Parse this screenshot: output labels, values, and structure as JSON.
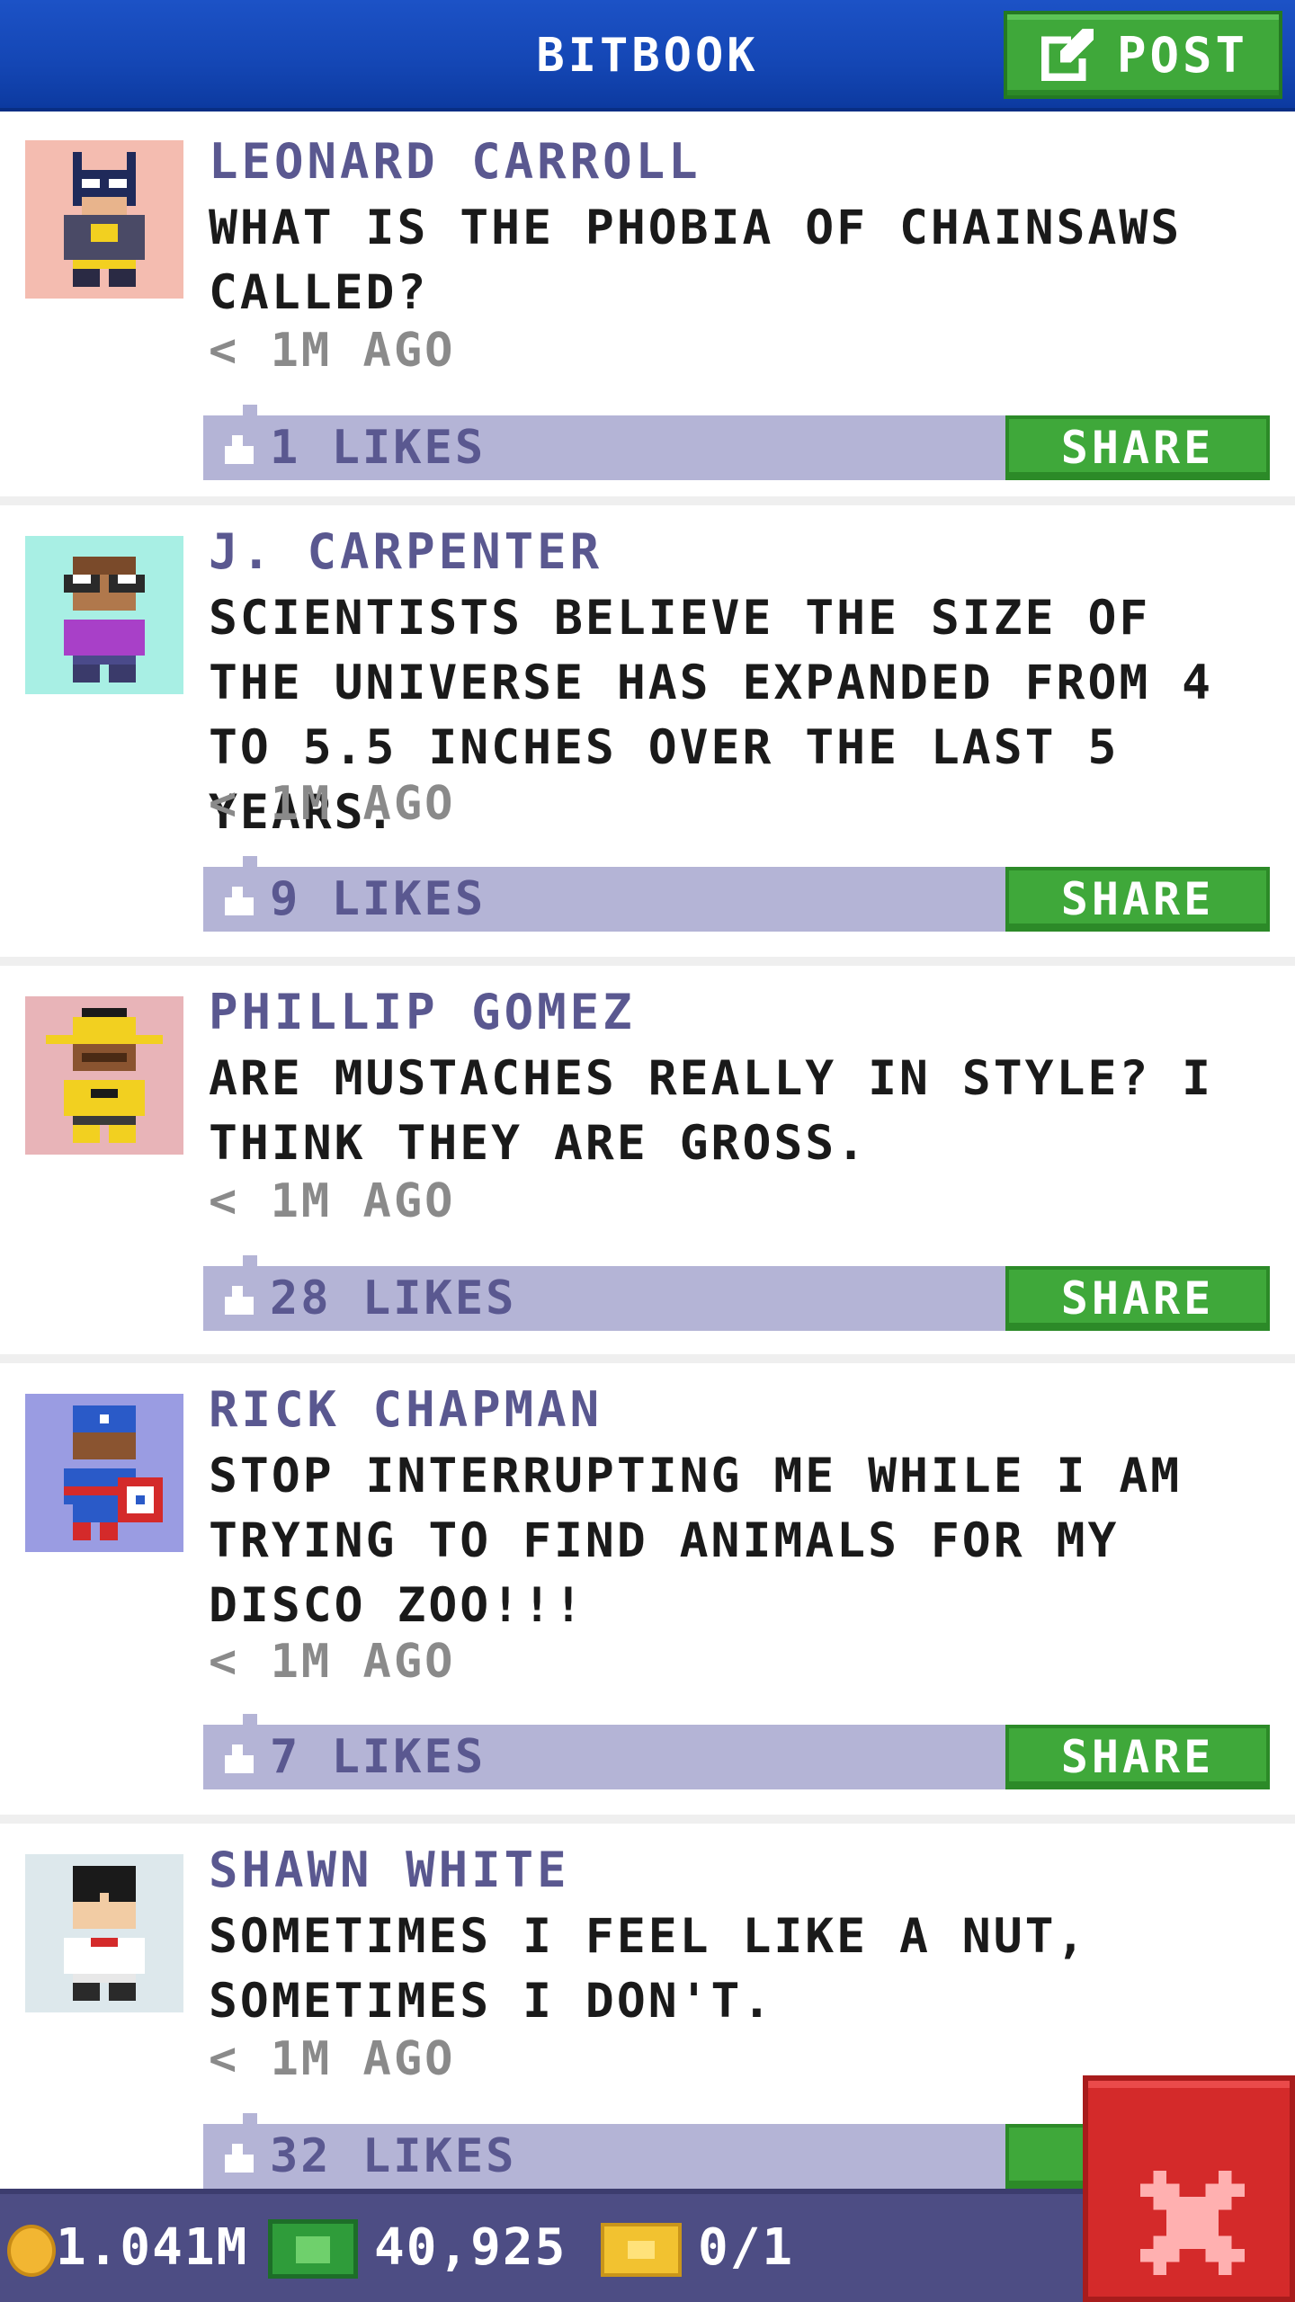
{
  "header": {
    "title": "BITBOOK",
    "post_label": "POST"
  },
  "posts": [
    {
      "author": "LEONARD CARROLL",
      "text": "WHAT IS THE PHOBIA OF CHAINSAWS CALLED?",
      "time": "< 1M AGO",
      "likes": "1 LIKES",
      "share_label": "SHARE",
      "avatar_bg": "#f4bcb0"
    },
    {
      "author": "J. CARPENTER",
      "text": "SCIENTISTS BELIEVE THE SIZE OF THE UNIVERSE HAS EXPANDED FROM 4 TO 5.5 INCHES OVER THE LAST 5 YEARS.",
      "time": "< 1M AGO",
      "likes": "9 LIKES",
      "share_label": "SHARE",
      "avatar_bg": "#a8efe4"
    },
    {
      "author": "PHILLIP GOMEZ",
      "text": "ARE MUSTACHES REALLY IN STYLE? I THINK THEY ARE GROSS.",
      "time": "< 1M AGO",
      "likes": "28 LIKES",
      "share_label": "SHARE",
      "avatar_bg": "#e8b4b8"
    },
    {
      "author": "RICK CHAPMAN",
      "text": "STOP INTERRUPTING ME WHILE I AM TRYING TO FIND ANIMALS FOR MY DISCO ZOO!!!",
      "time": "< 1M AGO",
      "likes": "7 LIKES",
      "share_label": "SHARE",
      "avatar_bg": "#9a9ce2"
    },
    {
      "author": "SHAWN WHITE",
      "text": "SOMETIMES I FEEL LIKE A NUT, SOMETIMES I DON'T.",
      "time": "< 1M AGO",
      "likes": "32 LIKES",
      "share_label": "S",
      "avatar_bg": "#dde8ec"
    }
  ],
  "status_bar": {
    "coins": "1.041M",
    "bux": "40,925",
    "tickets": "0/1"
  },
  "colors": {
    "header_blue": "#1446b4",
    "accent_green": "#3fa83a",
    "likes_bar": "#b4b4d6",
    "author_purple": "#5a5890",
    "close_red": "#d42a2a"
  }
}
